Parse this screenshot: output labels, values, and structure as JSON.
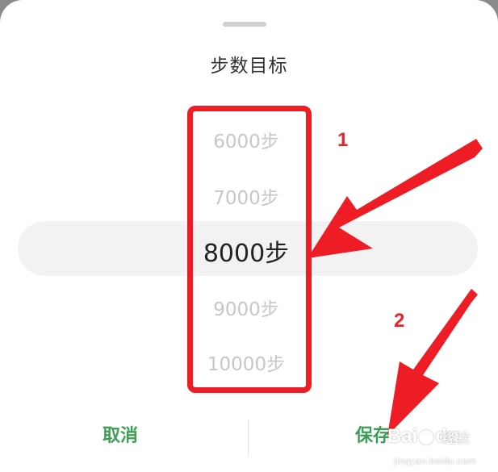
{
  "sheet": {
    "title": "步数目标"
  },
  "picker": {
    "options": [
      {
        "label": "6000步"
      },
      {
        "label": "7000步"
      },
      {
        "label": "8000步",
        "selected": true
      },
      {
        "label": "9000步"
      },
      {
        "label": "10000步"
      }
    ]
  },
  "actions": {
    "cancel_label": "取消",
    "save_label": "保存"
  },
  "annotations": {
    "step1": "1",
    "step2": "2",
    "color": "#ee1c24"
  },
  "watermark": {
    "logo": "Bai",
    "logo_suffix": "du",
    "cn": "经验",
    "url": "jingyan.baidu.com"
  },
  "colors": {
    "accent": "#3e9e57",
    "selected_text": "#222222",
    "unselected_text": "#c7c7c7"
  }
}
